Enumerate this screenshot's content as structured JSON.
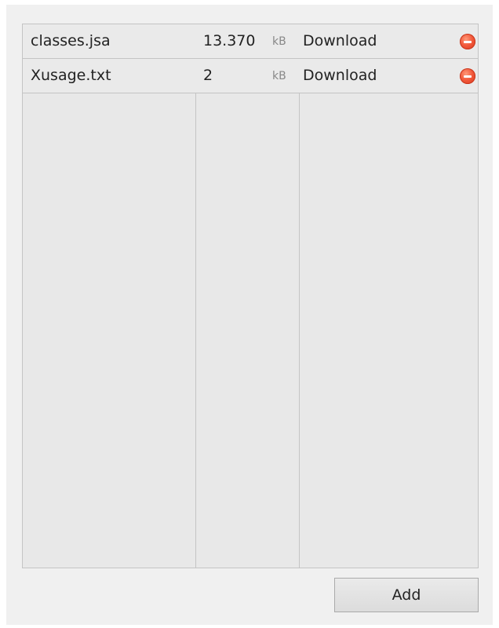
{
  "files": [
    {
      "name": "classes.jsa",
      "size": "13.370",
      "unit": "kB",
      "action": "Download",
      "remove_icon": "remove-circle-icon"
    },
    {
      "name": "Xusage.txt",
      "size": "2",
      "unit": "kB",
      "action": "Download",
      "remove_icon": "remove-circle-icon"
    }
  ],
  "add_button_label": "Add",
  "colors": {
    "remove_icon": "#e8482a",
    "table_bg": "#e8e8e8",
    "border": "#c4c4c4"
  }
}
